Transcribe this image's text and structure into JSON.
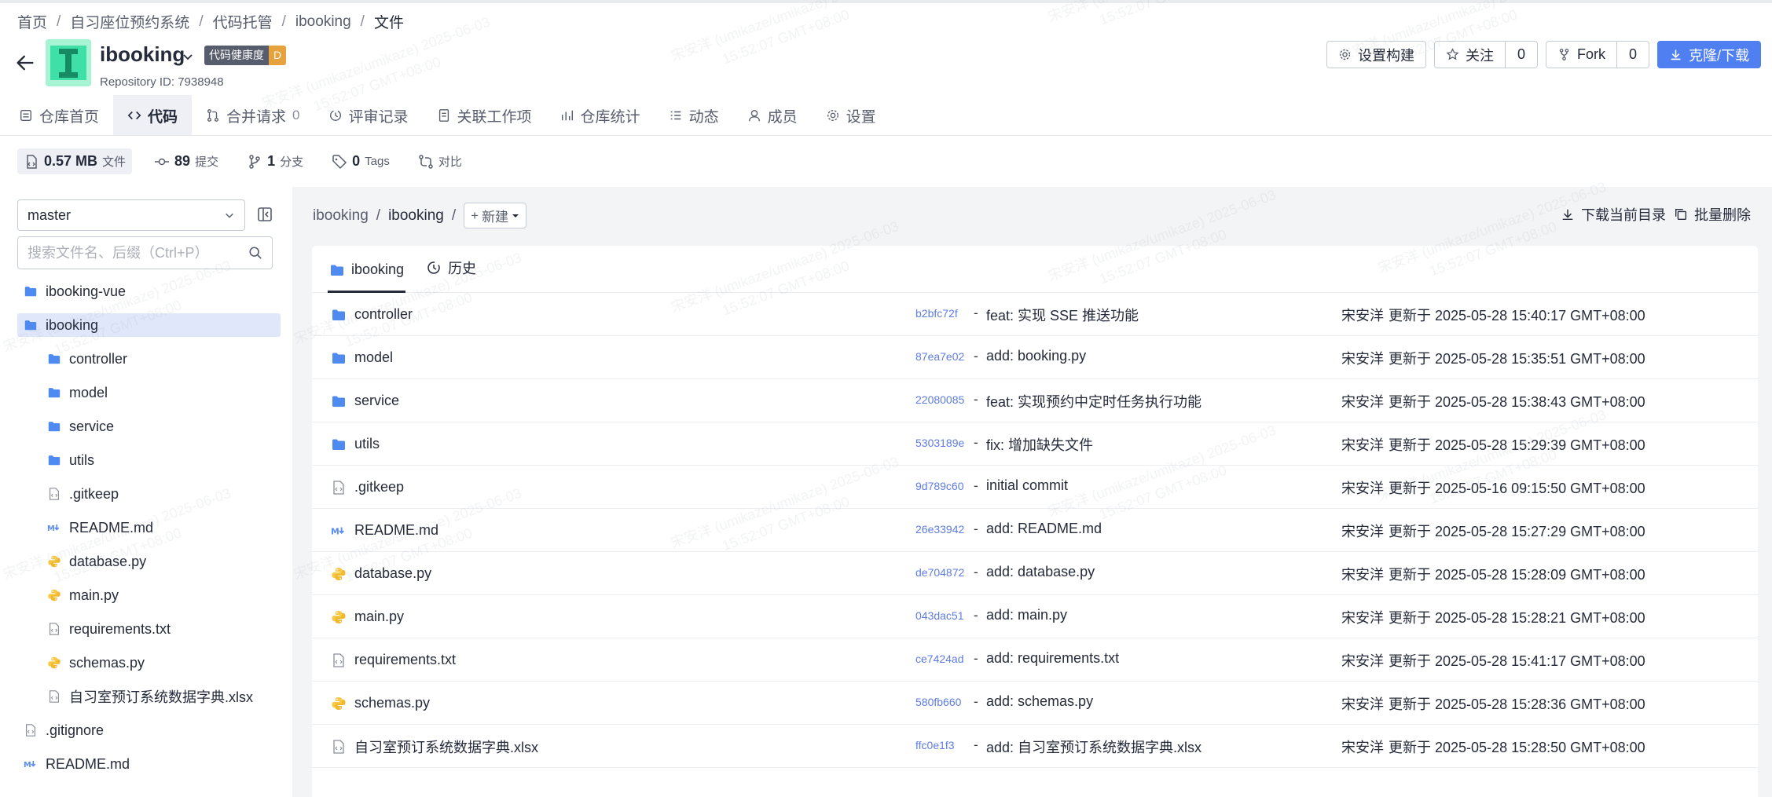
{
  "breadcrumb": [
    "首页",
    "自习座位预约系统",
    "代码托管",
    "ibooking",
    "文件"
  ],
  "repo": {
    "name": "ibooking",
    "health_label": "代码健康度",
    "health_grade": "D",
    "id_label": "Repository ID:",
    "id_value": "7938948"
  },
  "actions": {
    "build": "设置构建",
    "watch": "关注",
    "watch_count": "0",
    "fork": "Fork",
    "fork_count": "0",
    "clone": "克隆/下载"
  },
  "tabs": [
    {
      "label": "仓库首页",
      "icon": "home-doc-icon"
    },
    {
      "label": "代码",
      "icon": "code-icon",
      "active": true
    },
    {
      "label": "合并请求",
      "icon": "merge-request-icon",
      "badge": "0"
    },
    {
      "label": "评审记录",
      "icon": "review-icon"
    },
    {
      "label": "关联工作项",
      "icon": "workitem-icon"
    },
    {
      "label": "仓库统计",
      "icon": "chart-icon"
    },
    {
      "label": "动态",
      "icon": "activity-icon"
    },
    {
      "label": "成员",
      "icon": "user-icon"
    },
    {
      "label": "设置",
      "icon": "gear-icon"
    }
  ],
  "stats": {
    "size_value": "0.57 MB",
    "size_label": "文件",
    "commits_value": "89",
    "commits_label": "提交",
    "branches_value": "1",
    "branches_label": "分支",
    "tags_value": "0",
    "tags_label": "Tags",
    "compare_label": "对比"
  },
  "sidebar": {
    "branch": "master",
    "search_placeholder": "搜索文件名、后缀（Ctrl+P）",
    "tree": [
      {
        "label": "ibooking-vue",
        "type": "folder",
        "level": "top"
      },
      {
        "label": "ibooking",
        "type": "folder",
        "level": "top",
        "selected": true
      },
      {
        "label": "controller",
        "type": "folder",
        "level": "child"
      },
      {
        "label": "model",
        "type": "folder",
        "level": "child"
      },
      {
        "label": "service",
        "type": "folder",
        "level": "child"
      },
      {
        "label": "utils",
        "type": "folder",
        "level": "child"
      },
      {
        "label": ".gitkeep",
        "type": "file",
        "level": "child"
      },
      {
        "label": "README.md",
        "type": "md",
        "level": "child"
      },
      {
        "label": "database.py",
        "type": "py",
        "level": "child"
      },
      {
        "label": "main.py",
        "type": "py",
        "level": "child"
      },
      {
        "label": "requirements.txt",
        "type": "file",
        "level": "child"
      },
      {
        "label": "schemas.py",
        "type": "py",
        "level": "child"
      },
      {
        "label": "自习室预订系统数据字典.xlsx",
        "type": "file",
        "level": "child"
      },
      {
        "label": ".gitignore",
        "type": "file",
        "level": "top"
      },
      {
        "label": "README.md",
        "type": "md",
        "level": "top"
      }
    ]
  },
  "main": {
    "path_root": "ibooking",
    "path_current": "ibooking",
    "new_label": "新建",
    "download_dir": "下载当前目录",
    "batch_delete": "批量删除",
    "tab_files": "ibooking",
    "tab_history": "历史",
    "files": [
      {
        "name": "controller",
        "type": "folder",
        "hash": "b2bfc72f",
        "message": "feat: 实现 SSE 推送功能",
        "author": "宋安洋",
        "updated": "更新于 2025-05-28 15:40:17 GMT+08:00"
      },
      {
        "name": "model",
        "type": "folder",
        "hash": "87ea7e02",
        "message": "add: booking.py",
        "author": "宋安洋",
        "updated": "更新于 2025-05-28 15:35:51 GMT+08:00"
      },
      {
        "name": "service",
        "type": "folder",
        "hash": "22080085",
        "message": "feat: 实现预约中定时任务执行功能",
        "author": "宋安洋",
        "updated": "更新于 2025-05-28 15:38:43 GMT+08:00"
      },
      {
        "name": "utils",
        "type": "folder",
        "hash": "5303189e",
        "message": "fix: 增加缺失文件",
        "author": "宋安洋",
        "updated": "更新于 2025-05-28 15:29:39 GMT+08:00"
      },
      {
        "name": ".gitkeep",
        "type": "file",
        "hash": "9d789c60",
        "message": "initial commit",
        "author": "宋安洋",
        "updated": "更新于 2025-05-16 09:15:50 GMT+08:00"
      },
      {
        "name": "README.md",
        "type": "md",
        "hash": "26e33942",
        "message": "add: README.md",
        "author": "宋安洋",
        "updated": "更新于 2025-05-28 15:27:29 GMT+08:00"
      },
      {
        "name": "database.py",
        "type": "py",
        "hash": "de704872",
        "message": "add: database.py",
        "author": "宋安洋",
        "updated": "更新于 2025-05-28 15:28:09 GMT+08:00"
      },
      {
        "name": "main.py",
        "type": "py",
        "hash": "043dac51",
        "message": "add: main.py",
        "author": "宋安洋",
        "updated": "更新于 2025-05-28 15:28:21 GMT+08:00"
      },
      {
        "name": "requirements.txt",
        "type": "file",
        "hash": "ce7424ad",
        "message": "add: requirements.txt",
        "author": "宋安洋",
        "updated": "更新于 2025-05-28 15:41:17 GMT+08:00"
      },
      {
        "name": "schemas.py",
        "type": "py",
        "hash": "580fb660",
        "message": "add: schemas.py",
        "author": "宋安洋",
        "updated": "更新于 2025-05-28 15:28:36 GMT+08:00"
      },
      {
        "name": "自习室预订系统数据字典.xlsx",
        "type": "file",
        "hash": "ffc0e1f3",
        "message": "add: 自习室预订系统数据字典.xlsx",
        "author": "宋安洋",
        "updated": "更新于 2025-05-28 15:28:50 GMT+08:00"
      }
    ]
  },
  "watermark": {
    "line1": "宋安洋 (umikaze/umikaze) 2025-06-03",
    "line2": "15:52:07 GMT+08:00"
  },
  "colors": {
    "accent": "#4f7ff0",
    "folder": "#4e8af0",
    "python": "#f7c948",
    "markdown": "#5a8df0",
    "health_grade": "#e6a23c",
    "hash_link": "#5e7ce0"
  }
}
